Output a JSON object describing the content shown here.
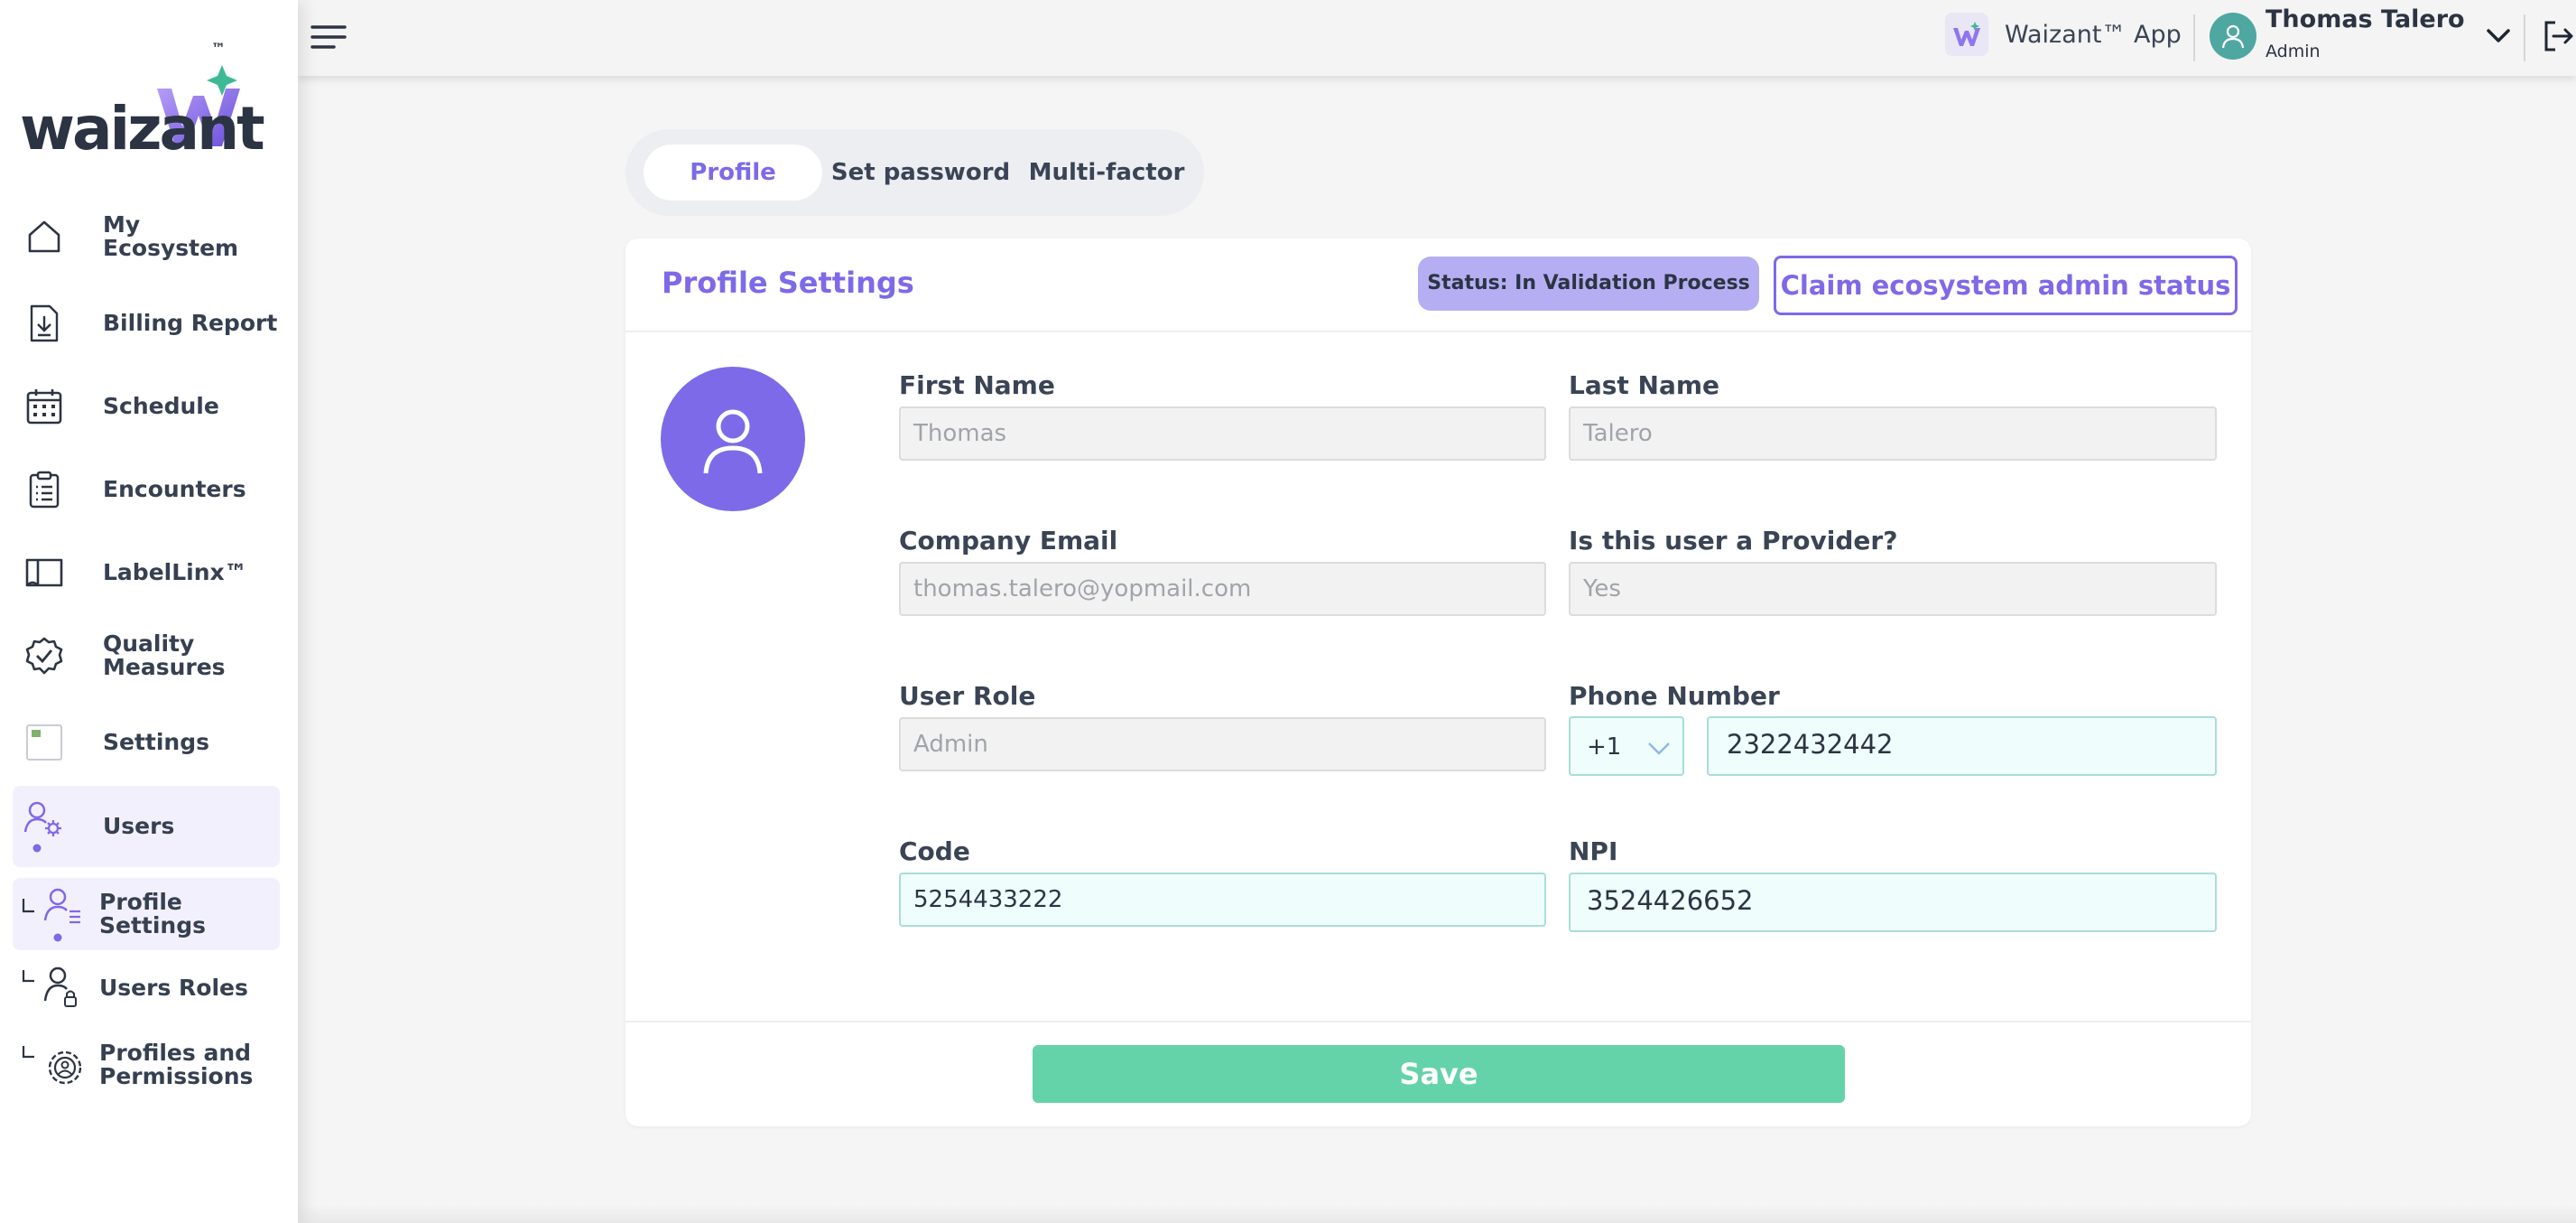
{
  "brand": {
    "name": "waizant",
    "tm": "™"
  },
  "sidebar": {
    "items": [
      {
        "label": "My Ecosystem",
        "icon": "home-icon"
      },
      {
        "label": "Billing Report",
        "icon": "download-doc-icon"
      },
      {
        "label": "Schedule",
        "icon": "calendar-icon"
      },
      {
        "label": "Encounters",
        "icon": "clipboard-icon"
      },
      {
        "label": "LabelLinx™",
        "icon": "folder-icon"
      },
      {
        "label": "Quality Measures",
        "icon": "verified-badge-icon"
      },
      {
        "label": "Settings",
        "icon": "broken-image-icon"
      },
      {
        "label": "Users",
        "icon": "user-gear-icon"
      }
    ],
    "subitems": [
      {
        "label": "Profile Settings",
        "icon": "user-settings-icon"
      },
      {
        "label": "Users Roles",
        "icon": "user-lock-icon"
      },
      {
        "label": "Profiles and Permissions",
        "icon": "gear-icon"
      }
    ]
  },
  "header": {
    "app_label": "Waizant™ App",
    "user_name": "Thomas Talero",
    "user_role": "Admin"
  },
  "tabs": [
    "Profile",
    "Set password",
    "Multi-factor"
  ],
  "card": {
    "title": "Profile Settings",
    "status": "Status: In Validation Process",
    "claim_button": "Claim ecosystem admin status",
    "save_button": "Save"
  },
  "form": {
    "first_name": {
      "label": "First Name",
      "value": "Thomas"
    },
    "last_name": {
      "label": "Last Name",
      "value": "Talero"
    },
    "company_email": {
      "label": "Company Email",
      "value": "thomas.talero@yopmail.com"
    },
    "is_provider": {
      "label": "Is this user a Provider?",
      "value": "Yes"
    },
    "user_role": {
      "label": "User Role",
      "value": "Admin"
    },
    "phone": {
      "label": "Phone Number",
      "code": "+1",
      "value": "2322432442"
    },
    "code": {
      "label": "Code",
      "value": "5254433222"
    },
    "npi": {
      "label": "NPI",
      "value": "3524426652"
    }
  },
  "colors": {
    "accent": "#7d6ae8",
    "save": "#65d3aa",
    "status_badge": "#b6aef3",
    "avatar_teal": "#4fa7a1"
  }
}
